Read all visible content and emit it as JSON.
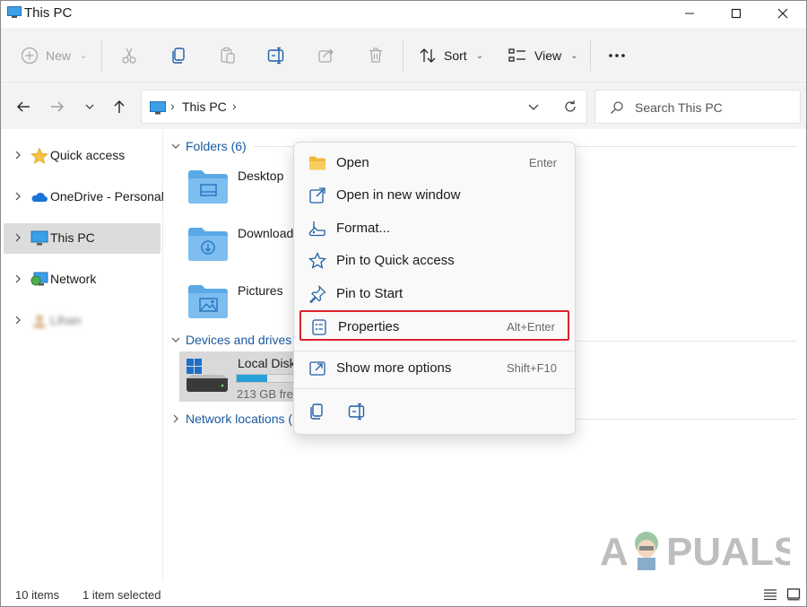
{
  "window": {
    "title": "This PC"
  },
  "toolbar": {
    "new_label": "New",
    "sort_label": "Sort",
    "view_label": "View",
    "icons": [
      "cut-icon",
      "copy-icon",
      "paste-icon",
      "rename-icon",
      "share-icon",
      "delete-icon",
      "more-icon"
    ]
  },
  "address": {
    "crumbs": [
      "This PC"
    ],
    "search_placeholder": "Search This PC"
  },
  "sidebar": {
    "items": [
      {
        "label": "Quick access",
        "icon": "star-icon"
      },
      {
        "label": "OneDrive - Personal",
        "icon": "cloud-icon"
      },
      {
        "label": "This PC",
        "icon": "monitor-icon",
        "selected": true
      },
      {
        "label": "Network",
        "icon": "network-icon"
      },
      {
        "label": "Lihan",
        "icon": "user-icon",
        "blurred": true
      }
    ]
  },
  "main": {
    "folders_heading": "Folders (6)",
    "folders": [
      {
        "name": "Desktop",
        "icon": "desktop-folder-icon"
      },
      {
        "name": "Downloads",
        "icon": "downloads-folder-icon"
      },
      {
        "name": "Pictures",
        "icon": "pictures-folder-icon"
      }
    ],
    "devices_heading": "Devices and drives",
    "disk": {
      "name": "Local Disk (C:)",
      "free": "213 GB free",
      "used_fraction": 0.44
    },
    "network_heading": "Network locations (",
    "disk_tail": ")"
  },
  "context_menu": {
    "items": [
      {
        "label": "Open",
        "shortcut": "Enter",
        "icon": "folder-open-icon"
      },
      {
        "label": "Open in new window",
        "shortcut": "",
        "icon": "new-window-icon"
      },
      {
        "label": "Format...",
        "shortcut": "",
        "icon": "format-icon"
      },
      {
        "label": "Pin to Quick access",
        "shortcut": "",
        "icon": "star-outline-icon"
      },
      {
        "label": "Pin to Start",
        "shortcut": "",
        "icon": "pin-icon"
      },
      {
        "label": "Properties",
        "shortcut": "Alt+Enter",
        "icon": "properties-icon",
        "highlighted": true
      },
      {
        "label": "Show more options",
        "shortcut": "Shift+F10",
        "icon": "more-options-icon"
      }
    ],
    "bottom_icons": [
      "copy-icon",
      "rename-icon"
    ]
  },
  "status": {
    "count": "10 items",
    "selection": "1 item selected"
  },
  "watermark": {
    "text": "A  PUALS"
  },
  "colors": {
    "accent": "#1a5aa0",
    "highlight_border": "#d9232e",
    "selected_bg": "#dcdcdc",
    "folder": "#5aa9e6"
  }
}
